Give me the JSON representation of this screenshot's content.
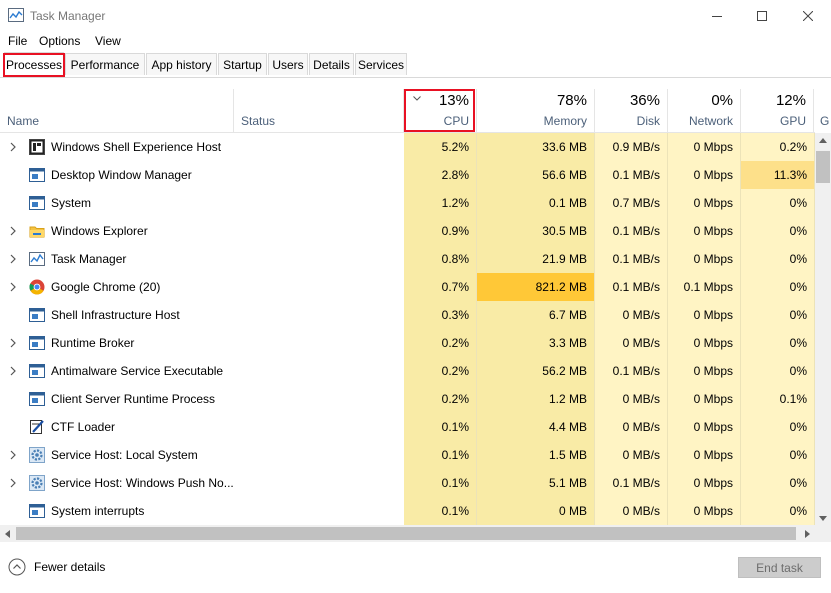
{
  "window": {
    "title": "Task Manager"
  },
  "menu": [
    "File",
    "Options",
    "View"
  ],
  "tabs": [
    "Processes",
    "Performance",
    "App history",
    "Startup",
    "Users",
    "Details",
    "Services"
  ],
  "header": {
    "name": "Name",
    "status": "Status",
    "cpu": {
      "pct": "13%",
      "label": "CPU"
    },
    "memory": {
      "pct": "78%",
      "label": "Memory"
    },
    "disk": {
      "pct": "36%",
      "label": "Disk"
    },
    "network": {
      "pct": "0%",
      "label": "Network"
    },
    "gpu": {
      "pct": "12%",
      "label": "GPU"
    },
    "gpu_engine_partial": "G"
  },
  "processes": [
    {
      "name": "Windows Shell Experience Host",
      "expandable": true,
      "icon": "shell-experience-icon",
      "cpu": "5.2%",
      "memory": "33.6 MB",
      "disk": "0.9 MB/s",
      "network": "0 Mbps",
      "gpu": "0.2%"
    },
    {
      "name": "Desktop Window Manager",
      "expandable": false,
      "icon": "window-app-icon",
      "cpu": "2.8%",
      "memory": "56.6 MB",
      "disk": "0.1 MB/s",
      "network": "0 Mbps",
      "gpu": "11.3%"
    },
    {
      "name": "System",
      "expandable": false,
      "icon": "window-app-icon",
      "cpu": "1.2%",
      "memory": "0.1 MB",
      "disk": "0.7 MB/s",
      "network": "0 Mbps",
      "gpu": "0%"
    },
    {
      "name": "Windows Explorer",
      "expandable": true,
      "icon": "folder-icon",
      "cpu": "0.9%",
      "memory": "30.5 MB",
      "disk": "0.1 MB/s",
      "network": "0 Mbps",
      "gpu": "0%"
    },
    {
      "name": "Task Manager",
      "expandable": true,
      "icon": "task-manager-icon",
      "cpu": "0.8%",
      "memory": "21.9 MB",
      "disk": "0.1 MB/s",
      "network": "0 Mbps",
      "gpu": "0%"
    },
    {
      "name": "Google Chrome (20)",
      "expandable": true,
      "icon": "chrome-icon",
      "cpu": "0.7%",
      "memory": "821.2 MB",
      "disk": "0.1 MB/s",
      "network": "0.1 Mbps",
      "gpu": "0%"
    },
    {
      "name": "Shell Infrastructure Host",
      "expandable": false,
      "icon": "window-app-icon",
      "cpu": "0.3%",
      "memory": "6.7 MB",
      "disk": "0 MB/s",
      "network": "0 Mbps",
      "gpu": "0%"
    },
    {
      "name": "Runtime Broker",
      "expandable": true,
      "icon": "window-app-icon",
      "cpu": "0.2%",
      "memory": "3.3 MB",
      "disk": "0 MB/s",
      "network": "0 Mbps",
      "gpu": "0%"
    },
    {
      "name": "Antimalware Service Executable",
      "expandable": true,
      "icon": "window-app-icon",
      "cpu": "0.2%",
      "memory": "56.2 MB",
      "disk": "0.1 MB/s",
      "network": "0 Mbps",
      "gpu": "0%"
    },
    {
      "name": "Client Server Runtime Process",
      "expandable": false,
      "icon": "window-app-icon",
      "cpu": "0.2%",
      "memory": "1.2 MB",
      "disk": "0 MB/s",
      "network": "0 Mbps",
      "gpu": "0.1%"
    },
    {
      "name": "CTF Loader",
      "expandable": false,
      "icon": "ctf-loader-icon",
      "cpu": "0.1%",
      "memory": "4.4 MB",
      "disk": "0 MB/s",
      "network": "0 Mbps",
      "gpu": "0%"
    },
    {
      "name": "Service Host: Local System",
      "expandable": true,
      "icon": "service-gear-icon",
      "cpu": "0.1%",
      "memory": "1.5 MB",
      "disk": "0 MB/s",
      "network": "0 Mbps",
      "gpu": "0%"
    },
    {
      "name": "Service Host: Windows Push No...",
      "expandable": true,
      "icon": "service-gear-icon",
      "cpu": "0.1%",
      "memory": "5.1 MB",
      "disk": "0.1 MB/s",
      "network": "0 Mbps",
      "gpu": "0%"
    },
    {
      "name": "System interrupts",
      "expandable": false,
      "icon": "window-app-icon",
      "cpu": "0.1%",
      "memory": "0 MB",
      "disk": "0 MB/s",
      "network": "0 Mbps",
      "gpu": "0%"
    }
  ],
  "footer": {
    "fewer_details": "Fewer details",
    "end_task": "End task"
  },
  "colors": {
    "heat_light": "#fff4c4",
    "heat_mid": "#f9eba6",
    "heat_gpu_high": "#fde08a",
    "heat_memory_high": "#ffc837",
    "highlight_box": "#e81123",
    "header_label": "#4c607a"
  }
}
